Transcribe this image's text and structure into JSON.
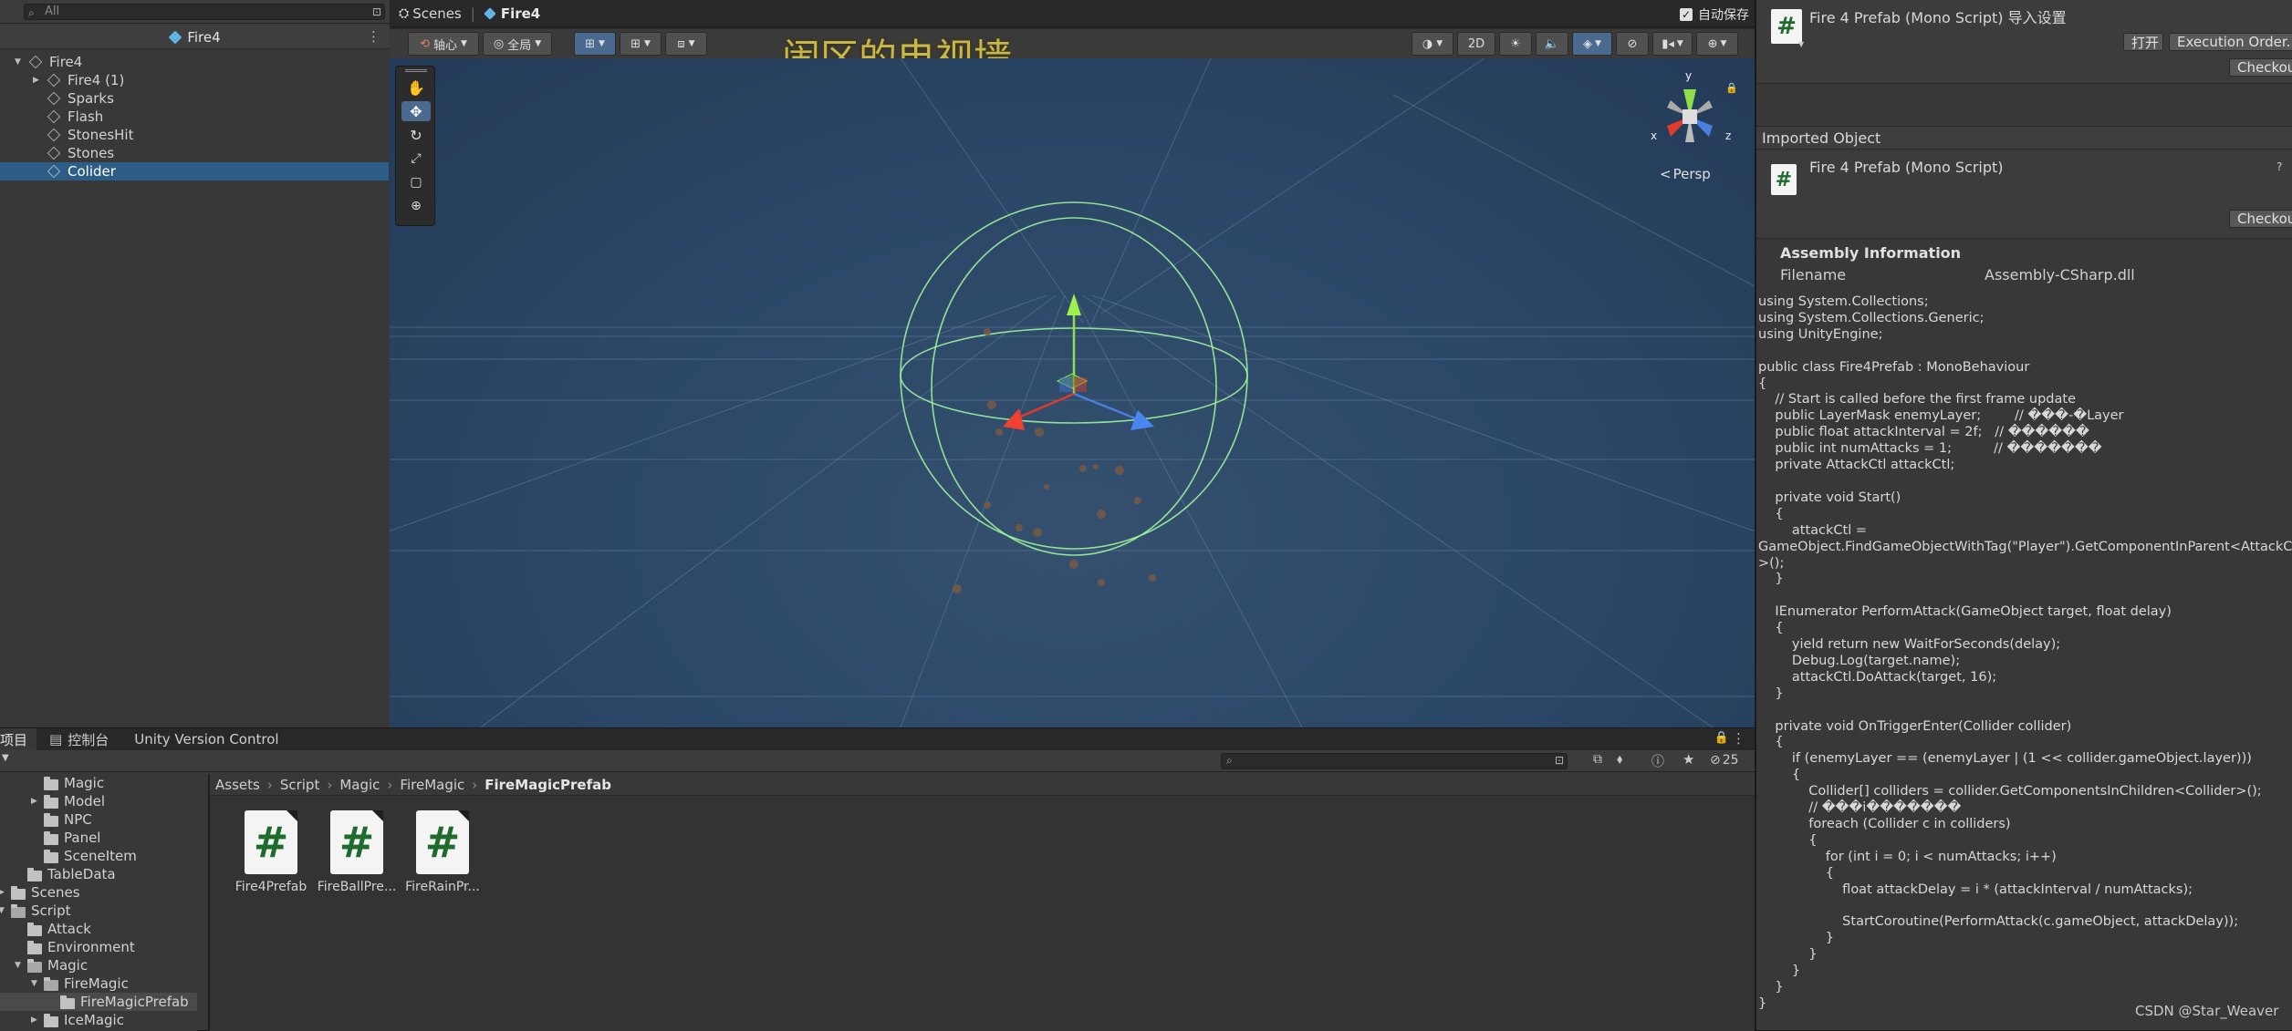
{
  "hierarchy": {
    "search_placeholder": "All",
    "scene_name": "Fire4",
    "items": [
      {
        "label": "Fire4",
        "depth": 0,
        "expanded": true,
        "selected": false
      },
      {
        "label": "Fire4 (1)",
        "depth": 1,
        "expanded": false,
        "selected": false
      },
      {
        "label": "Sparks",
        "depth": 1,
        "selected": false
      },
      {
        "label": "Flash",
        "depth": 1,
        "selected": false
      },
      {
        "label": "StonesHit",
        "depth": 1,
        "selected": false
      },
      {
        "label": "Stones",
        "depth": 1,
        "selected": false
      },
      {
        "label": "Colider",
        "depth": 1,
        "selected": true
      }
    ]
  },
  "scene": {
    "breadcrumb_scenes": "Scenes",
    "breadcrumb_current": "Fire4",
    "autosave_label": "自动保存",
    "autosave_checked": true,
    "pivot_label": "轴心",
    "global_label": "全局",
    "mode_2d": "2D",
    "overlay_title": "闹区的电视墙",
    "persp_label": "Persp",
    "gizmo_axes": {
      "y": "y",
      "x": "x",
      "z": "z"
    }
  },
  "bottom": {
    "tabs": [
      "项目",
      "控制台",
      "Unity Version Control"
    ],
    "hidden_count": "25",
    "breadcrumb": [
      "Assets",
      "Script",
      "Magic",
      "FireMagic",
      "FireMagicPrefab"
    ],
    "tree": [
      {
        "label": "Magic",
        "indent": 2,
        "arrow": false
      },
      {
        "label": "Model",
        "indent": 2,
        "arrow": true
      },
      {
        "label": "NPC",
        "indent": 2,
        "arrow": false
      },
      {
        "label": "Panel",
        "indent": 2,
        "arrow": false
      },
      {
        "label": "SceneItem",
        "indent": 2,
        "arrow": false
      },
      {
        "label": "TableData",
        "indent": 1,
        "arrow": false
      },
      {
        "label": "Scenes",
        "indent": 0,
        "arrow": true
      },
      {
        "label": "Script",
        "indent": 0,
        "arrow": true,
        "open": true
      },
      {
        "label": "Attack",
        "indent": 1,
        "arrow": false
      },
      {
        "label": "Environment",
        "indent": 1,
        "arrow": false
      },
      {
        "label": "Magic",
        "indent": 1,
        "arrow": true,
        "open": true
      },
      {
        "label": "FireMagic",
        "indent": 2,
        "arrow": true,
        "open": true
      },
      {
        "label": "FireMagicPrefab",
        "indent": 3,
        "arrow": false,
        "selected": true
      },
      {
        "label": "IceMagic",
        "indent": 2,
        "arrow": true
      }
    ],
    "assets": [
      {
        "label": "Fire4Prefab",
        "icon": "#"
      },
      {
        "label": "FireBallPre...",
        "icon": "#"
      },
      {
        "label": "FireRainPr...",
        "icon": "#"
      }
    ]
  },
  "inspector": {
    "title": "Fire 4 Prefab (Mono Script) 导入设置",
    "open_button": "打开",
    "exec_order_button": "Execution Order...",
    "checkout_button": "Checkout",
    "imported_object_label": "Imported Object",
    "object_title": "Fire 4 Prefab (Mono Script)",
    "help_icon": "?",
    "assembly_heading": "Assembly Information",
    "filename_label": "Filename",
    "filename_value": "Assembly-CSharp.dll",
    "code": "using System.Collections;\nusing System.Collections.Generic;\nusing UnityEngine;\n\npublic class Fire4Prefab : MonoBehaviour\n{\n    // Start is called before the first frame update\n    public LayerMask enemyLayer;        // ���-�Layer\n    public float attackInterval = 2f;   // ������\n    public int numAttacks = 1;          // �������\n    private AttackCtl attackCtl;\n\n    private void Start()\n    {\n        attackCtl =\nGameObject.FindGameObjectWithTag(\"Player\").GetComponentInParent<AttackCtl\n>();\n    }\n\n    IEnumerator PerformAttack(GameObject target, float delay)\n    {\n        yield return new WaitForSeconds(delay);\n        Debug.Log(target.name);\n        attackCtl.DoAttack(target, 16);\n    }\n\n    private void OnTriggerEnter(Collider collider)\n    {\n        if (enemyLayer == (enemyLayer | (1 << collider.gameObject.layer)))\n        {\n            Collider[] colliders = collider.GetComponentsInChildren<Collider>();\n            // ���i�������\n            foreach (Collider c in colliders)\n            {\n                for (int i = 0; i < numAttacks; i++)\n                {\n                    float attackDelay = i * (attackInterval / numAttacks);\n\n                    StartCoroutine(PerformAttack(c.gameObject, attackDelay));\n                }\n            }\n        }\n    }\n}",
    "watermark": "CSDN @Star_Weaver"
  }
}
